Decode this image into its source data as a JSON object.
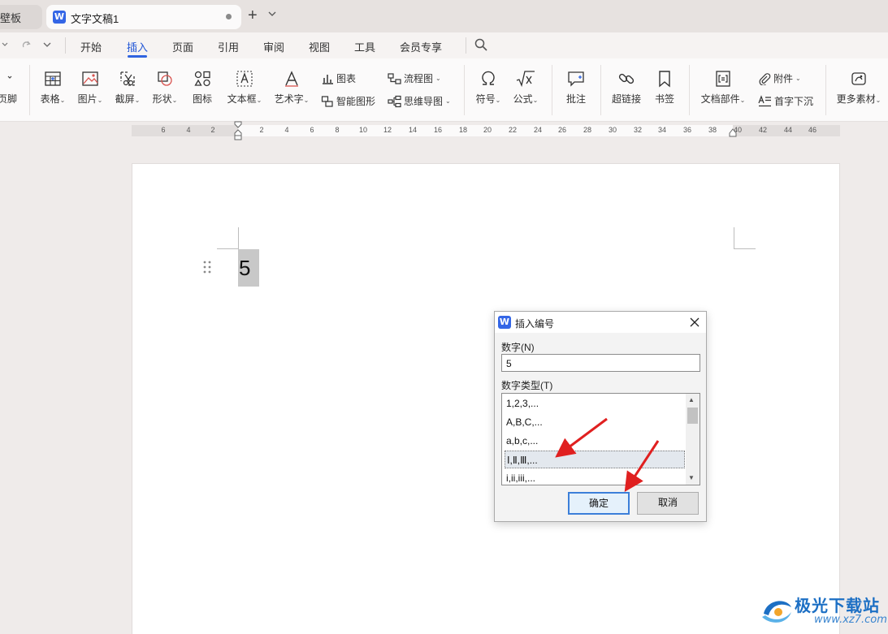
{
  "tabs": {
    "prev_label": "壁板",
    "active_title": "文字文稿1"
  },
  "menu": {
    "items": [
      "开始",
      "插入",
      "页面",
      "引用",
      "审阅",
      "视图",
      "工具",
      "会员专享"
    ],
    "active": "插入"
  },
  "ribbon": {
    "footer_label": "页脚",
    "table": "表格",
    "picture": "图片",
    "screenshot": "截屏",
    "shape": "形状",
    "icon": "图标",
    "textbox": "文本框",
    "wordart": "艺术字",
    "chart": "图表",
    "smart_graphic": "智能图形",
    "flowchart": "流程图",
    "mindmap": "思维导图",
    "symbol": "符号",
    "formula": "公式",
    "comment": "批注",
    "hyperlink": "超链接",
    "bookmark": "书签",
    "doc_parts": "文档部件",
    "attachment": "附件",
    "dropcap": "首字下沉",
    "more_assets": "更多素材"
  },
  "ruler": {
    "ticks": [
      "6",
      "4",
      "2",
      "2",
      "4",
      "6",
      "8",
      "10",
      "12",
      "14",
      "16",
      "18",
      "20",
      "22",
      "24",
      "26",
      "28",
      "30",
      "32",
      "34",
      "36",
      "38",
      "40",
      "42",
      "44",
      "46"
    ]
  },
  "document": {
    "content": "5"
  },
  "dialog": {
    "title": "插入编号",
    "number_label": "数字(N)",
    "number_value": "5",
    "type_label": "数字类型(T)",
    "types": [
      "1,2,3,...",
      "A,B,C,...",
      "a,b,c,...",
      "Ⅰ,Ⅱ,Ⅲ,...",
      "i,ii,iii,..."
    ],
    "selected_index": 3,
    "ok_label": "确定",
    "cancel_label": "取消"
  },
  "watermark": {
    "title": "极光下载站",
    "url": "www.xz7.com"
  },
  "colors": {
    "accent": "#2f63e0",
    "arrow": "#e02020",
    "selection": "#c8c8c8"
  }
}
